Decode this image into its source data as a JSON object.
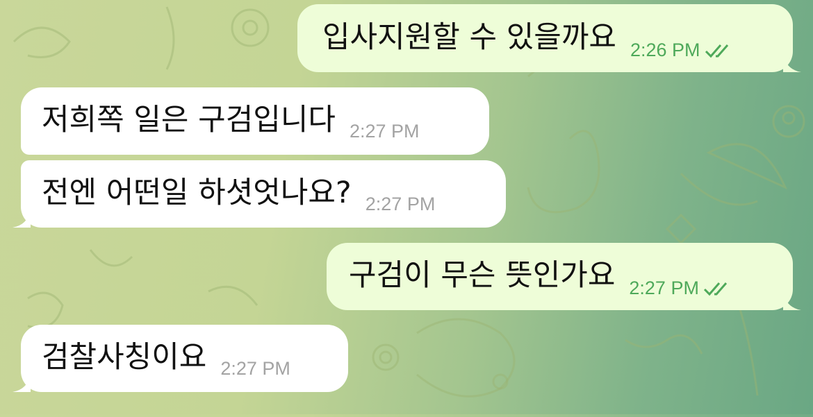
{
  "messages": [
    {
      "direction": "outgoing",
      "text": "입사지원할 수 있을까요",
      "time": "2:26 PM",
      "status": "read"
    },
    {
      "direction": "incoming",
      "text": "저희쪽 일은 구검입니다",
      "time": "2:27 PM"
    },
    {
      "direction": "incoming",
      "text": "전엔 어떤일 하셧엇나요?",
      "time": "2:27 PM"
    },
    {
      "direction": "outgoing",
      "text": "구검이 무슨 뜻인가요",
      "time": "2:27 PM",
      "status": "read"
    },
    {
      "direction": "incoming",
      "text": "검찰사칭이요",
      "time": "2:27 PM"
    }
  ],
  "colors": {
    "incoming_bubble": "#ffffff",
    "outgoing_bubble": "#eefdd8",
    "outgoing_meta": "#4ea95a",
    "incoming_meta": "#a3a3a3"
  },
  "icons": {
    "read_status": "double-check-icon"
  }
}
